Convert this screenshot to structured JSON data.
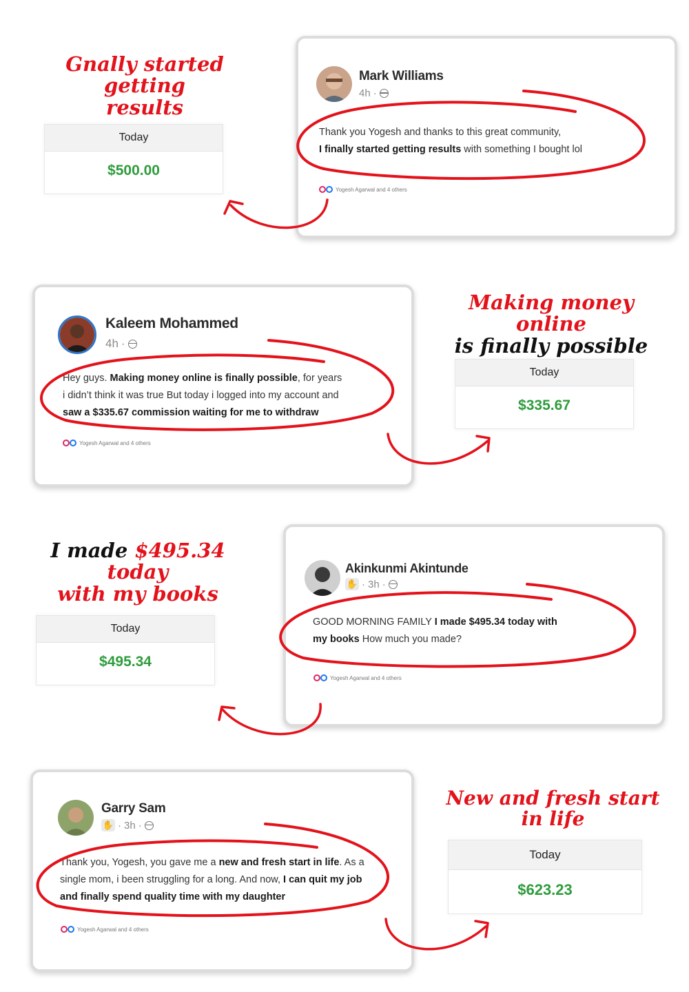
{
  "colors": {
    "accent_red": "#e3121b",
    "money_green": "#2e9c3c",
    "card_border": "#dcdcdc"
  },
  "testimonials": [
    {
      "headline": {
        "line1": "Gnally started getting",
        "line2": "results"
      },
      "stat": {
        "label": "Today",
        "value": "$500.00"
      },
      "post": {
        "author": "Mark Williams",
        "time": "4h",
        "text_parts": [
          "Thank you Yogesh and thanks to this great community,",
          "I finally started getting results",
          " with something I bought lol"
        ],
        "reactions": "Yogesh Agarwal and 4 others"
      }
    },
    {
      "headline": {
        "line1": "Making money online",
        "line2": "is finally possible"
      },
      "stat": {
        "label": "Today",
        "value": "$335.67"
      },
      "post": {
        "author": "Kaleem Mohammed",
        "time": "4h",
        "text_parts": [
          "Hey guys. ",
          "Making money online is finally possible",
          ", for years",
          "i didn’t think it was true But today i logged into my account and",
          "saw a $335.67 commission waiting for me to withdraw"
        ],
        "reactions": "Yogesh Agarwal and 4 others"
      }
    },
    {
      "headline": {
        "line1_black": "I made ",
        "line1_red": "$495.34 today",
        "line2": "with  my books"
      },
      "stat": {
        "label": "Today",
        "value": "$495.34"
      },
      "post": {
        "author": "Akinkunmi Akintunde",
        "time": "3h",
        "text_parts": [
          "GOOD MORNING FAMILY ",
          "I made $495.34 today with",
          "my books",
          " How much you made?"
        ],
        "reactions": "Yogesh Agarwal and 4 others"
      }
    },
    {
      "headline": {
        "line1": "New and fresh start in life"
      },
      "stat": {
        "label": "Today",
        "value": "$623.23"
      },
      "post": {
        "author": "Garry Sam",
        "time": "3h",
        "text_parts": [
          "Thank you, Yogesh, you gave me a ",
          "new and fresh start in life",
          ". As a",
          "single mom, i been struggling for a long. And now, ",
          "I can quit my job",
          "and finally spend quality time with my daughter"
        ],
        "reactions": "Yogesh Agarwal and 4 others"
      }
    }
  ]
}
